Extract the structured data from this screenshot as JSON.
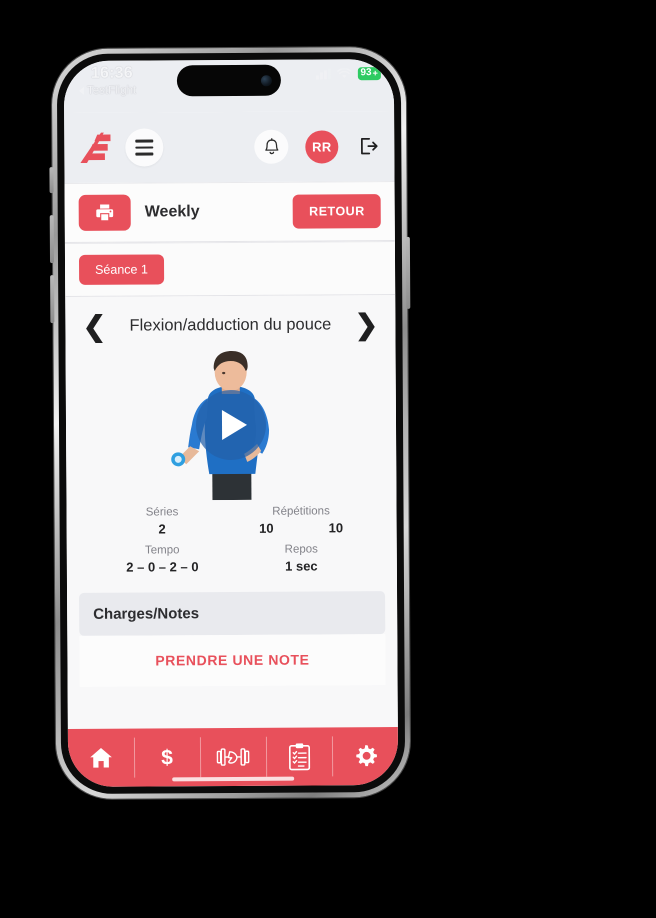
{
  "status_bar": {
    "time": "16:36",
    "carrier_back_label": "TestFlight",
    "battery_level": "93",
    "battery_charging_glyph": "+",
    "signal_icon": "cellular-signal-icon",
    "wifi_icon": "wifi-icon"
  },
  "header": {
    "logo_icon": "brand-logo-icon",
    "menu_icon": "hamburger-menu-icon",
    "bell_icon": "notification-bell-icon",
    "avatar_initials": "RR",
    "logout_icon": "logout-icon"
  },
  "weekly": {
    "print_icon": "printer-icon",
    "title": "Weekly",
    "back_label": "RETOUR"
  },
  "sessions": {
    "chips": [
      {
        "label": "Séance 1"
      }
    ]
  },
  "exercise": {
    "prev_icon": "chevron-left-icon",
    "next_icon": "chevron-right-icon",
    "title": "Flexion/adduction du pouce",
    "video": {
      "play_icon": "play-icon",
      "alt": "man-performing-thumb-flexion-with-dumbbell"
    },
    "stats": {
      "series_label": "Séries",
      "series_value": "2",
      "reps_label": "Répétitions",
      "reps_values": [
        "10",
        "10"
      ],
      "tempo_label": "Tempo",
      "tempo_value": "2 – 0 – 2 – 0",
      "rest_label": "Repos",
      "rest_value": "1 sec"
    }
  },
  "notes": {
    "header": "Charges/Notes",
    "take_note_label": "PRENDRE UNE NOTE"
  },
  "bottom_nav": {
    "items": [
      {
        "icon": "home-icon",
        "name": "nav-home"
      },
      {
        "icon": "dollar-icon",
        "name": "nav-billing"
      },
      {
        "icon": "dumbbell-icon",
        "name": "nav-workouts"
      },
      {
        "icon": "clipboard-checklist-icon",
        "name": "nav-programs"
      },
      {
        "icon": "gear-icon",
        "name": "nav-settings"
      }
    ]
  },
  "colors": {
    "accent_red": "#e8505b",
    "header_bg": "#eceef2",
    "content_bg": "#f7f7f8",
    "battery_green": "#2ecb62"
  }
}
